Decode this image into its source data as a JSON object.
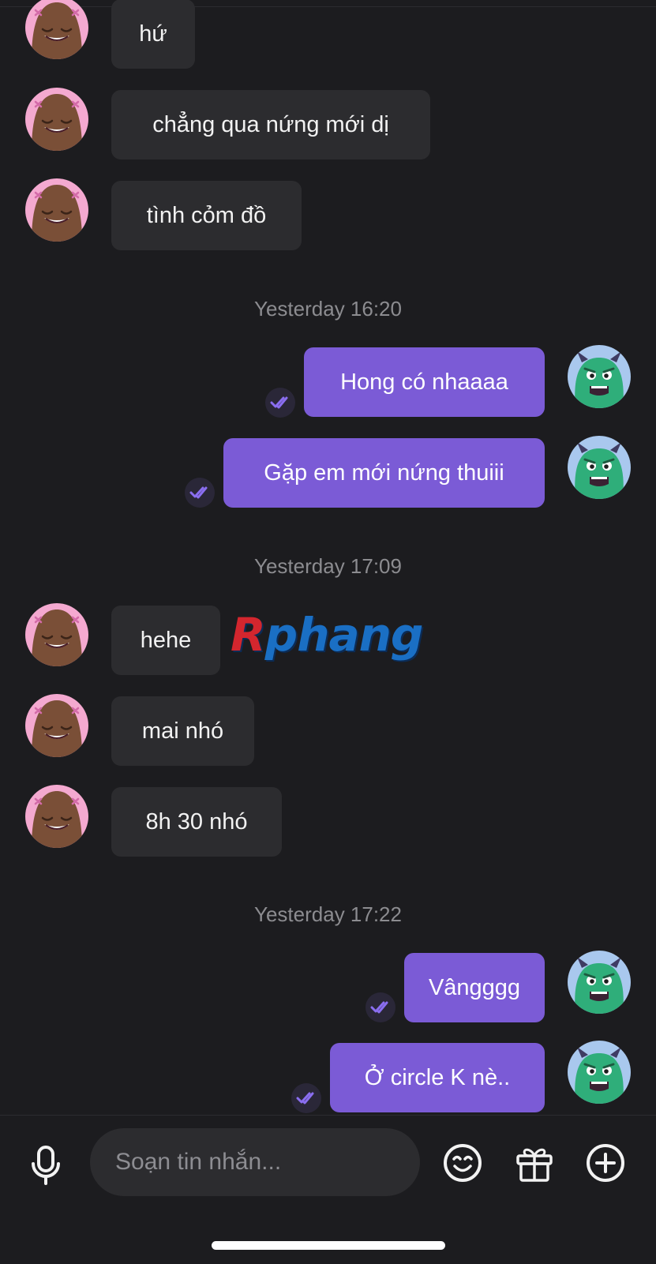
{
  "messages": {
    "m1": {
      "text": "hứ"
    },
    "m2": {
      "text": "chẳng qua nứng mới dị"
    },
    "m3": {
      "text": "tình cỏm đồ"
    },
    "t1": {
      "text": "Yesterday 16:20"
    },
    "m4": {
      "text": "Hong có nhaaaa"
    },
    "m5": {
      "text": "Gặp em mới nứng thuiii"
    },
    "t2": {
      "text": "Yesterday 17:09"
    },
    "m6": {
      "text": "hehe"
    },
    "m7": {
      "text": "mai nhó"
    },
    "m8": {
      "text": "8h 30 nhó"
    },
    "t3": {
      "text": "Yesterday 17:22"
    },
    "m9": {
      "text": "Vângggg"
    },
    "m10": {
      "text": "Ở circle K nè.."
    }
  },
  "watermark": {
    "first": "R",
    "rest": "phang"
  },
  "composer": {
    "placeholder": "Soạn tin nhắn..."
  },
  "icons": {
    "mic": "microphone-icon",
    "emoji": "smiley-icon",
    "gift": "gift-icon",
    "plus": "plus-circle-icon",
    "read": "double-check-icon"
  },
  "colors": {
    "background": "#1c1c1f",
    "incoming_bubble": "#2c2c2f",
    "outgoing_bubble": "#7b5bd6",
    "timestamp": "#8c8c90",
    "read_check": "#8a6ef0"
  }
}
